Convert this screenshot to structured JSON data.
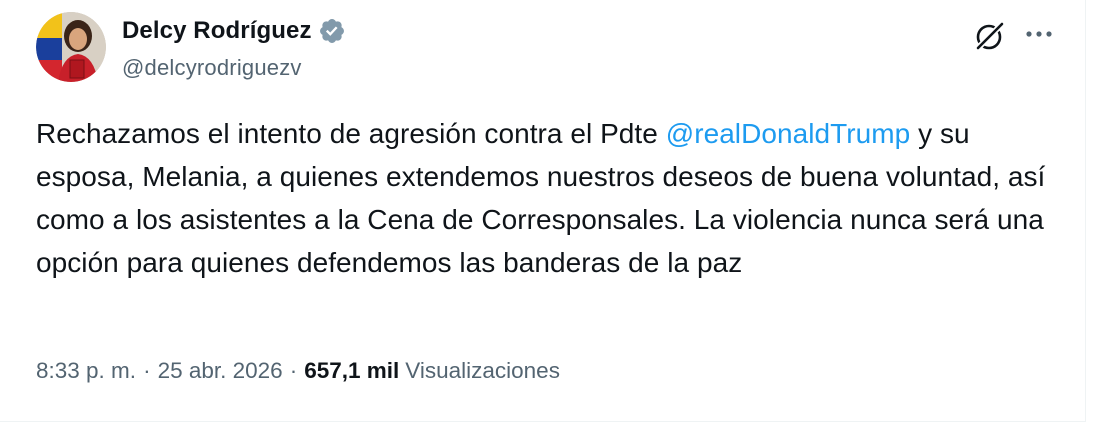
{
  "author": {
    "display_name": "Delcy Rodríguez",
    "handle": "@delcyrodriguezv",
    "verified_color": "#829aab"
  },
  "tweet": {
    "text_before_mention": "Rechazamos el intento de agresión contra el Pdte ",
    "mention": "@realDonaldTrump",
    "text_after_mention": " y su esposa, Melania, a quienes extendemos nuestros deseos de buena voluntad, así como a los asistentes a la Cena de Corresponsales. La violencia nunca será una opción para quienes defendemos las banderas de la paz"
  },
  "meta": {
    "time": "8:33 p. m.",
    "separator": "·",
    "date": "25 abr. 2026",
    "views_count": "657,1 mil",
    "views_label": "Visualizaciones"
  },
  "icons": {
    "verified": "verified-badge-icon",
    "grok": "grok-icon",
    "more": "more-options-icon"
  },
  "colors": {
    "text": "#0f1419",
    "secondary": "#536471",
    "link": "#1d9bf0"
  }
}
